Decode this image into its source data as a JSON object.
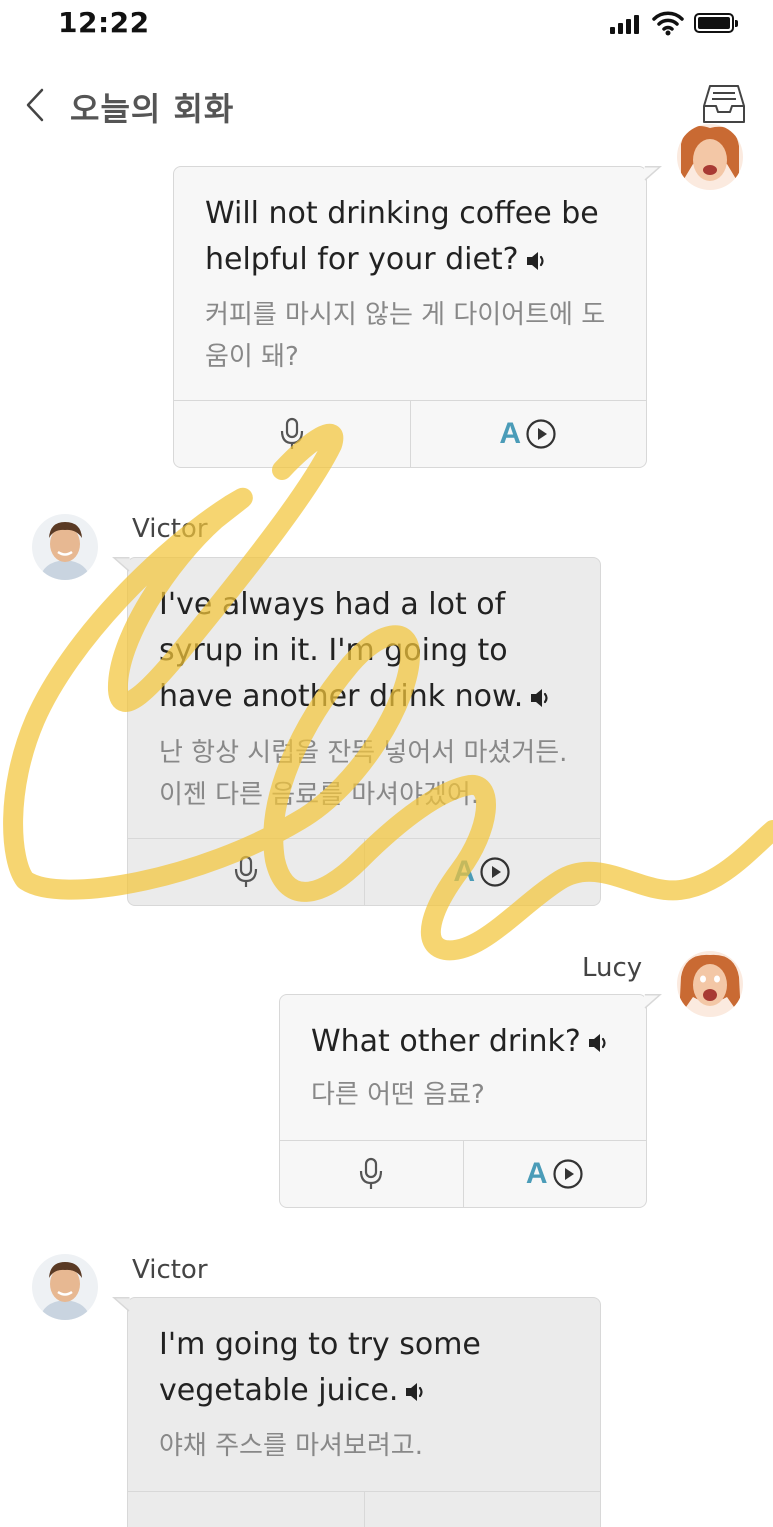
{
  "status_bar": {
    "time": "12:22"
  },
  "header": {
    "title": "오늘의 회화"
  },
  "messages": [
    {
      "speaker": "",
      "side": "right",
      "text_en": "Will not drinking coffee be helpful for your diet?",
      "text_ko": "커피를 마시지 않는 게 다이어트에 도움이 돼?"
    },
    {
      "speaker": "Victor",
      "side": "left",
      "text_en": "I've always had a lot of syrup in it. I'm going to have another drink now.",
      "text_ko": "난 항상 시럽을 잔뜩 넣어서 마셨거든. 이젠 다른 음료를 마셔야겠어."
    },
    {
      "speaker": "Lucy",
      "side": "right",
      "text_en": "What other drink?",
      "text_ko": "다른 어떤 음료?"
    },
    {
      "speaker": "Victor",
      "side": "left",
      "text_en": "I'm going to try some vegetable juice.",
      "text_ko": "야채 주스를 마셔보려고."
    }
  ],
  "action_letter": "A",
  "icons": {
    "back": "chevron-left-icon",
    "inbox": "inbox-tray-icon",
    "speaker": "speaker-icon",
    "mic": "microphone-icon",
    "play": "play-circle-icon"
  },
  "colors": {
    "accent": "#4b9cb8",
    "bubble_light": "#f7f7f7",
    "bubble_gray": "#ebebeb",
    "scribble": "#f3c53a"
  }
}
